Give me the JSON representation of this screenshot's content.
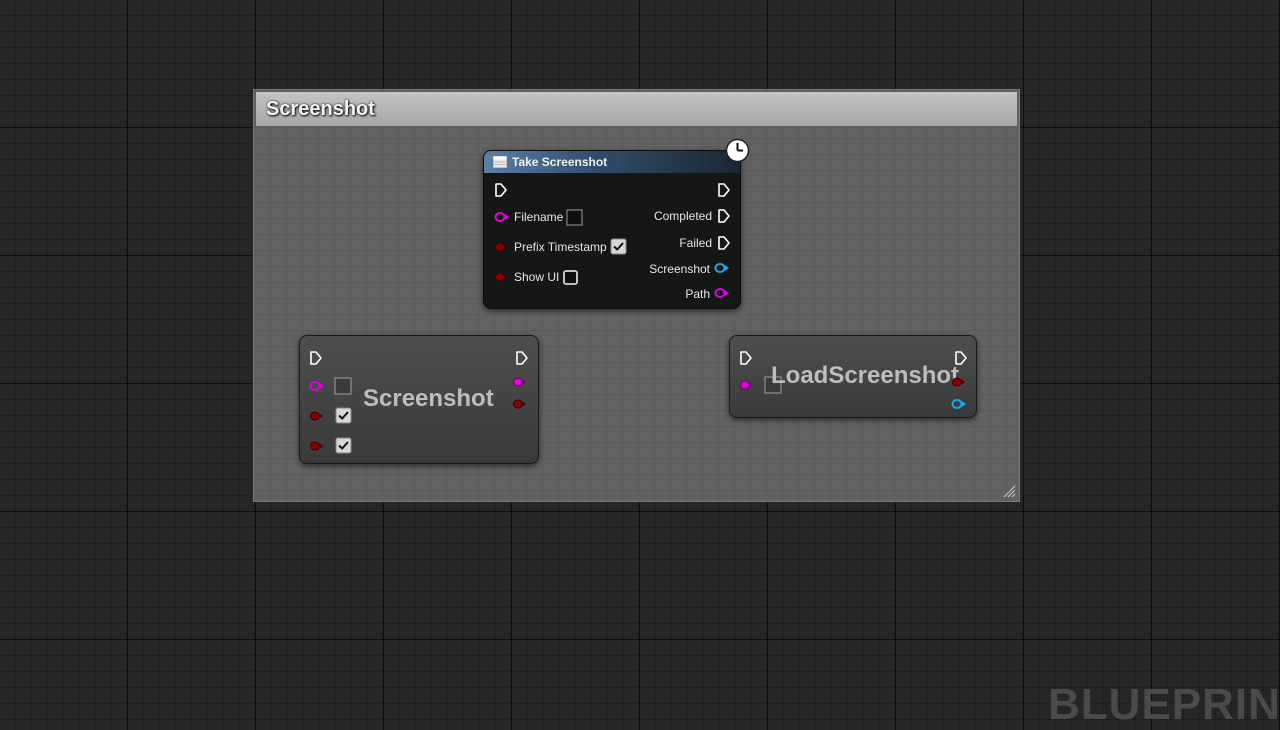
{
  "comment": {
    "title": "Screenshot"
  },
  "take_screenshot_node": {
    "title": "Take Screenshot",
    "inputs": {
      "filename": "Filename",
      "prefix_timestamp": "Prefix Timestamp",
      "show_ui": "Show UI"
    },
    "input_values": {
      "filename_empty": true,
      "prefix_timestamp_checked": true,
      "show_ui_checked": false
    },
    "outputs": {
      "completed": "Completed",
      "failed": "Failed",
      "screenshot": "Screenshot",
      "path": "Path"
    }
  },
  "collapsed_screenshot_node": {
    "title": "Screenshot"
  },
  "collapsed_load_node": {
    "title": "LoadScreenshot"
  },
  "watermark": "BLUEPRIN",
  "colors": {
    "exec_pin": "#ffffff",
    "string_pin": "#e000e0",
    "bool_pin": "#8a0000",
    "object_pin": "#1aa6e8",
    "header_blue": "#5b7fa6"
  }
}
